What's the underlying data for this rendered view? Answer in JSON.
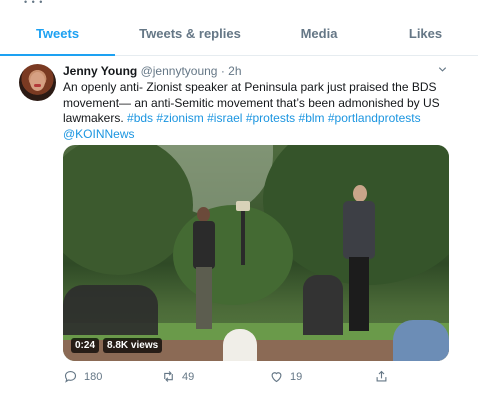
{
  "tabs": [
    {
      "label": "Tweets",
      "active": true
    },
    {
      "label": "Tweets & replies",
      "active": false
    },
    {
      "label": "Media",
      "active": false
    },
    {
      "label": "Likes",
      "active": false
    }
  ],
  "tweet": {
    "name": "Jenny Young",
    "handle": "@jennytyoung",
    "separator": "·",
    "time": "2h",
    "text_plain": "An openly anti- Zionist speaker at Peninsula park just praised the BDS movement— an anti-Semitic movement that’s been admonished by US lawmakers.",
    "hashtags": [
      "#bds",
      "#zionism",
      "#israel",
      "#protests",
      "#blm",
      "#portlandprotests"
    ],
    "mention": "@KOINNews",
    "video": {
      "duration": "0:24",
      "views": "8.8K views"
    },
    "actions": {
      "reply_count": "180",
      "retweet_count": "49",
      "like_count": "19"
    }
  },
  "icons": {
    "caret": "chevron-down-icon",
    "reply": "reply-icon",
    "retweet": "retweet-icon",
    "like": "heart-icon",
    "share": "share-icon"
  },
  "colors": {
    "accent": "#1da1f2",
    "link": "#1b95e0",
    "muted": "#657786",
    "text": "#14171a"
  }
}
